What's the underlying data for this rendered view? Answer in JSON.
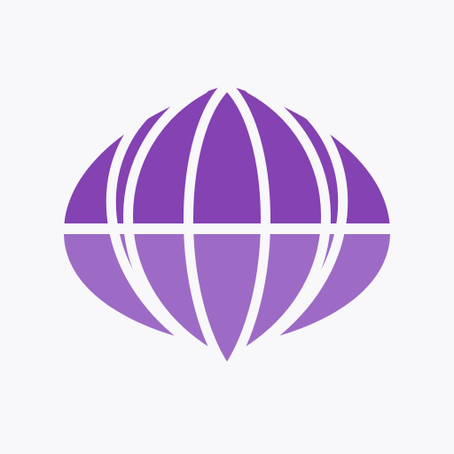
{
  "logo": {
    "icon": "onion-globe-icon",
    "colors": {
      "background": "#f8f7f9",
      "upper": "#8442b2",
      "lower": "#9d6bc5",
      "gap": "#f8f7f9"
    }
  }
}
